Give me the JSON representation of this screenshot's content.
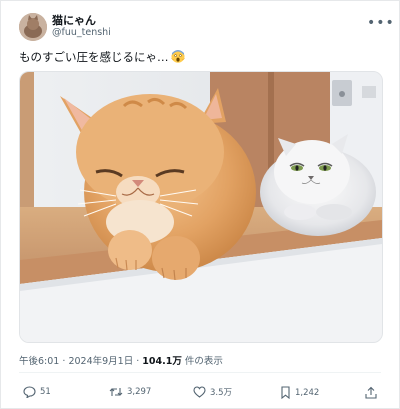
{
  "user": {
    "display_name": "猫にゃん",
    "handle": "@fuu_tenshi"
  },
  "tweet": {
    "text": "ものすごい圧を感じるにゃ…",
    "emoji_icon": "scream-face-icon"
  },
  "meta": {
    "time": "午後6:01",
    "date": "2024年9月1日",
    "views_count": "104.1万",
    "views_label": "件の表示"
  },
  "actions": {
    "replies": "51",
    "reposts": "3,297",
    "likes": "3.5万",
    "bookmarks": "1,242"
  },
  "colors": {
    "text": "#0f1419",
    "secondary": "#536471",
    "border": "#e6e8ea"
  }
}
